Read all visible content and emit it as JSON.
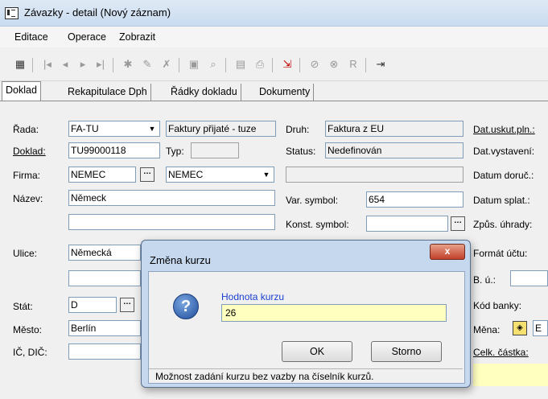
{
  "window": {
    "title": "Závazky - detail (Nový záznam)",
    "icon": "app-window-icon"
  },
  "menu": {
    "items": [
      {
        "label": "Editace",
        "accel": "E"
      },
      {
        "label": "Operace",
        "accel": "r"
      },
      {
        "label": "Zobrazit",
        "accel": "Z"
      }
    ]
  },
  "tabs": [
    {
      "label": "Doklad",
      "active": true
    },
    {
      "label": "Rekapitulace Dph",
      "active": false
    },
    {
      "label": "Řádky dokladu",
      "active": false
    },
    {
      "label": "Dokumenty",
      "active": false
    }
  ],
  "form": {
    "rada": {
      "label": "Řada:",
      "value": "FA-TU",
      "desc": "Faktury přijaté - tuze"
    },
    "doklad": {
      "label": "Doklad:",
      "value": "TU99000118"
    },
    "typ": {
      "label": "Typ:",
      "value": ""
    },
    "firma": {
      "label": "Firma:",
      "value": "NEMEC",
      "combo": "NEMEC"
    },
    "nazev": {
      "label": "Název:",
      "value": "Německ",
      "value2": ""
    },
    "ulice": {
      "label": "Ulice:",
      "value": "Německá",
      "value2": ""
    },
    "stat": {
      "label": "Stát:",
      "value": "D"
    },
    "mesto": {
      "label": "Město:",
      "value": "Berlín"
    },
    "icdic": {
      "label": "IČ, DIČ:",
      "value": ""
    },
    "druh": {
      "label": "Druh:",
      "value": "Faktura z EU"
    },
    "status": {
      "label": "Status:",
      "value": "Nedefinován"
    },
    "blank_field": {
      "value": ""
    },
    "var_symbol": {
      "label": "Var. symbol:",
      "value": "654"
    },
    "konst_symbol": {
      "label": "Konst. symbol:",
      "value": ""
    },
    "right_labels": {
      "dat_uskut": "Dat.uskut.pln.:",
      "dat_vystaveni": "Dat.vystavení:",
      "datum_doruc": "Datum doruč.:",
      "datum_splat": "Datum splat.:",
      "zpusob_uhrady": "Způs. úhrady:",
      "format_uctu": "Formát účtu:",
      "bu": "B. ú.:",
      "kod_banky": "Kód banky:",
      "mena": "Měna:",
      "mena_value": "E",
      "celk_castka": "Celk. částka:"
    }
  },
  "dialog": {
    "title": "Změna kurzu",
    "close_label": "x",
    "prompt_label": "Hodnota kurzu",
    "value": "26",
    "ok_label": "OK",
    "cancel_label": "Storno",
    "status": "Možnost zadání kurzu bez vazby na číselník kurzů.",
    "icon": "question-icon"
  }
}
